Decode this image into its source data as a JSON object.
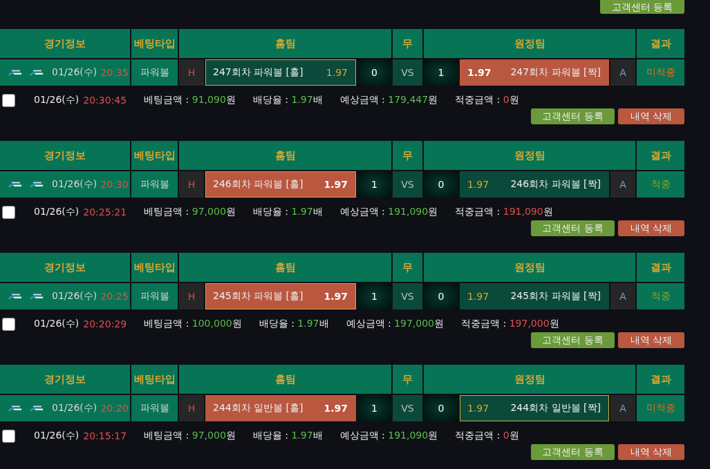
{
  "top_button": {
    "label": "고객센터 등록",
    "kind": "support"
  },
  "bets": [
    {
      "columns": [
        "경기정보",
        "베팅타입",
        "홈팀",
        "무",
        "원정팀",
        "결과"
      ],
      "match_date": "01/26(수)",
      "match_time": "20:35",
      "bet_type": "파워볼",
      "home_marker": "H",
      "home": {
        "label": "247회차 파워볼 [홀]",
        "odds": "1.97",
        "selected": true,
        "winner": false
      },
      "home_score": "0",
      "versus": "VS",
      "away_score": "1",
      "away": {
        "label": "247회차 파워볼 [짝]",
        "odds": "1.97",
        "selected": false,
        "winner": true
      },
      "away_marker": "A",
      "result": {
        "text": "미적중",
        "kind": "miss"
      },
      "checked": false,
      "bet_date": "01/26(수)",
      "bet_time": "20:30:45",
      "summary": [
        {
          "label": "베팅금액 :",
          "value": "91,090",
          "unit": "원",
          "kind": "amount"
        },
        {
          "label": "배당율 :",
          "value": "1.97",
          "unit": "배",
          "kind": "amount"
        },
        {
          "label": "예상금액 :",
          "value": "179,447",
          "unit": "원",
          "kind": "amount"
        },
        {
          "label": "적중금액 :",
          "value": "0",
          "unit": "원",
          "kind": "win"
        }
      ],
      "buttons": [
        {
          "label": "고객센터 등록",
          "kind": "support"
        },
        {
          "label": "내역 삭제",
          "kind": "delete"
        }
      ]
    },
    {
      "columns": [
        "경기정보",
        "베팅타입",
        "홈팀",
        "무",
        "원정팀",
        "결과"
      ],
      "match_date": "01/26(수)",
      "match_time": "20:30",
      "bet_type": "파워볼",
      "home_marker": "H",
      "home": {
        "label": "246회차 파워볼 [홀]",
        "odds": "1.97",
        "selected": true,
        "winner": true
      },
      "home_score": "1",
      "versus": "VS",
      "away_score": "0",
      "away": {
        "label": "246회차 파워볼 [짝]",
        "odds": "1.97",
        "selected": false,
        "winner": false
      },
      "away_marker": "A",
      "result": {
        "text": "적중",
        "kind": "hit"
      },
      "checked": false,
      "bet_date": "01/26(수)",
      "bet_time": "20:25:21",
      "summary": [
        {
          "label": "베팅금액 :",
          "value": "97,000",
          "unit": "원",
          "kind": "amount"
        },
        {
          "label": "배당율 :",
          "value": "1.97",
          "unit": "배",
          "kind": "amount"
        },
        {
          "label": "예상금액 :",
          "value": "191,090",
          "unit": "원",
          "kind": "amount"
        },
        {
          "label": "적중금액 :",
          "value": "191,090",
          "unit": "원",
          "kind": "win"
        }
      ],
      "buttons": [
        {
          "label": "고객센터 등록",
          "kind": "support"
        },
        {
          "label": "내역 삭제",
          "kind": "delete"
        }
      ]
    },
    {
      "columns": [
        "경기정보",
        "베팅타입",
        "홈팀",
        "무",
        "원정팀",
        "결과"
      ],
      "match_date": "01/26(수)",
      "match_time": "20:25",
      "bet_type": "파워볼",
      "home_marker": "H",
      "home": {
        "label": "245회차 파워볼 [홀]",
        "odds": "1.97",
        "selected": true,
        "winner": true
      },
      "home_score": "1",
      "versus": "VS",
      "away_score": "0",
      "away": {
        "label": "245회차 파워볼 [짝]",
        "odds": "1.97",
        "selected": false,
        "winner": false
      },
      "away_marker": "A",
      "result": {
        "text": "적중",
        "kind": "hit"
      },
      "checked": false,
      "bet_date": "01/26(수)",
      "bet_time": "20:20:29",
      "summary": [
        {
          "label": "베팅금액 :",
          "value": "100,000",
          "unit": "원",
          "kind": "amount"
        },
        {
          "label": "배당율 :",
          "value": "1.97",
          "unit": "배",
          "kind": "amount"
        },
        {
          "label": "예상금액 :",
          "value": "197,000",
          "unit": "원",
          "kind": "amount"
        },
        {
          "label": "적중금액 :",
          "value": "197,000",
          "unit": "원",
          "kind": "win"
        }
      ],
      "buttons": [
        {
          "label": "고객센터 등록",
          "kind": "support"
        },
        {
          "label": "내역 삭제",
          "kind": "delete"
        }
      ]
    },
    {
      "columns": [
        "경기정보",
        "베팅타입",
        "홈팀",
        "무",
        "원정팀",
        "결과"
      ],
      "match_date": "01/26(수)",
      "match_time": "20:20",
      "bet_type": "파워볼",
      "home_marker": "H",
      "home": {
        "label": "244회차 일반볼 [홀]",
        "odds": "1.97",
        "selected": false,
        "winner": true
      },
      "home_score": "1",
      "versus": "VS",
      "away_score": "0",
      "away": {
        "label": "244회차 일반볼 [짝]",
        "odds": "1.97",
        "selected": true,
        "winner": false
      },
      "away_marker": "A",
      "result": {
        "text": "미적중",
        "kind": "miss"
      },
      "checked": false,
      "bet_date": "01/26(수)",
      "bet_time": "20:15:17",
      "summary": [
        {
          "label": "베팅금액 :",
          "value": "97,000",
          "unit": "원",
          "kind": "amount"
        },
        {
          "label": "배당율 :",
          "value": "1.97",
          "unit": "배",
          "kind": "amount"
        },
        {
          "label": "예상금액 :",
          "value": "191,090",
          "unit": "원",
          "kind": "amount"
        },
        {
          "label": "적중금액 :",
          "value": "0",
          "unit": "원",
          "kind": "win"
        }
      ],
      "buttons": [
        {
          "label": "고객센터 등록",
          "kind": "support"
        },
        {
          "label": "내역 삭제",
          "kind": "delete"
        }
      ]
    }
  ]
}
